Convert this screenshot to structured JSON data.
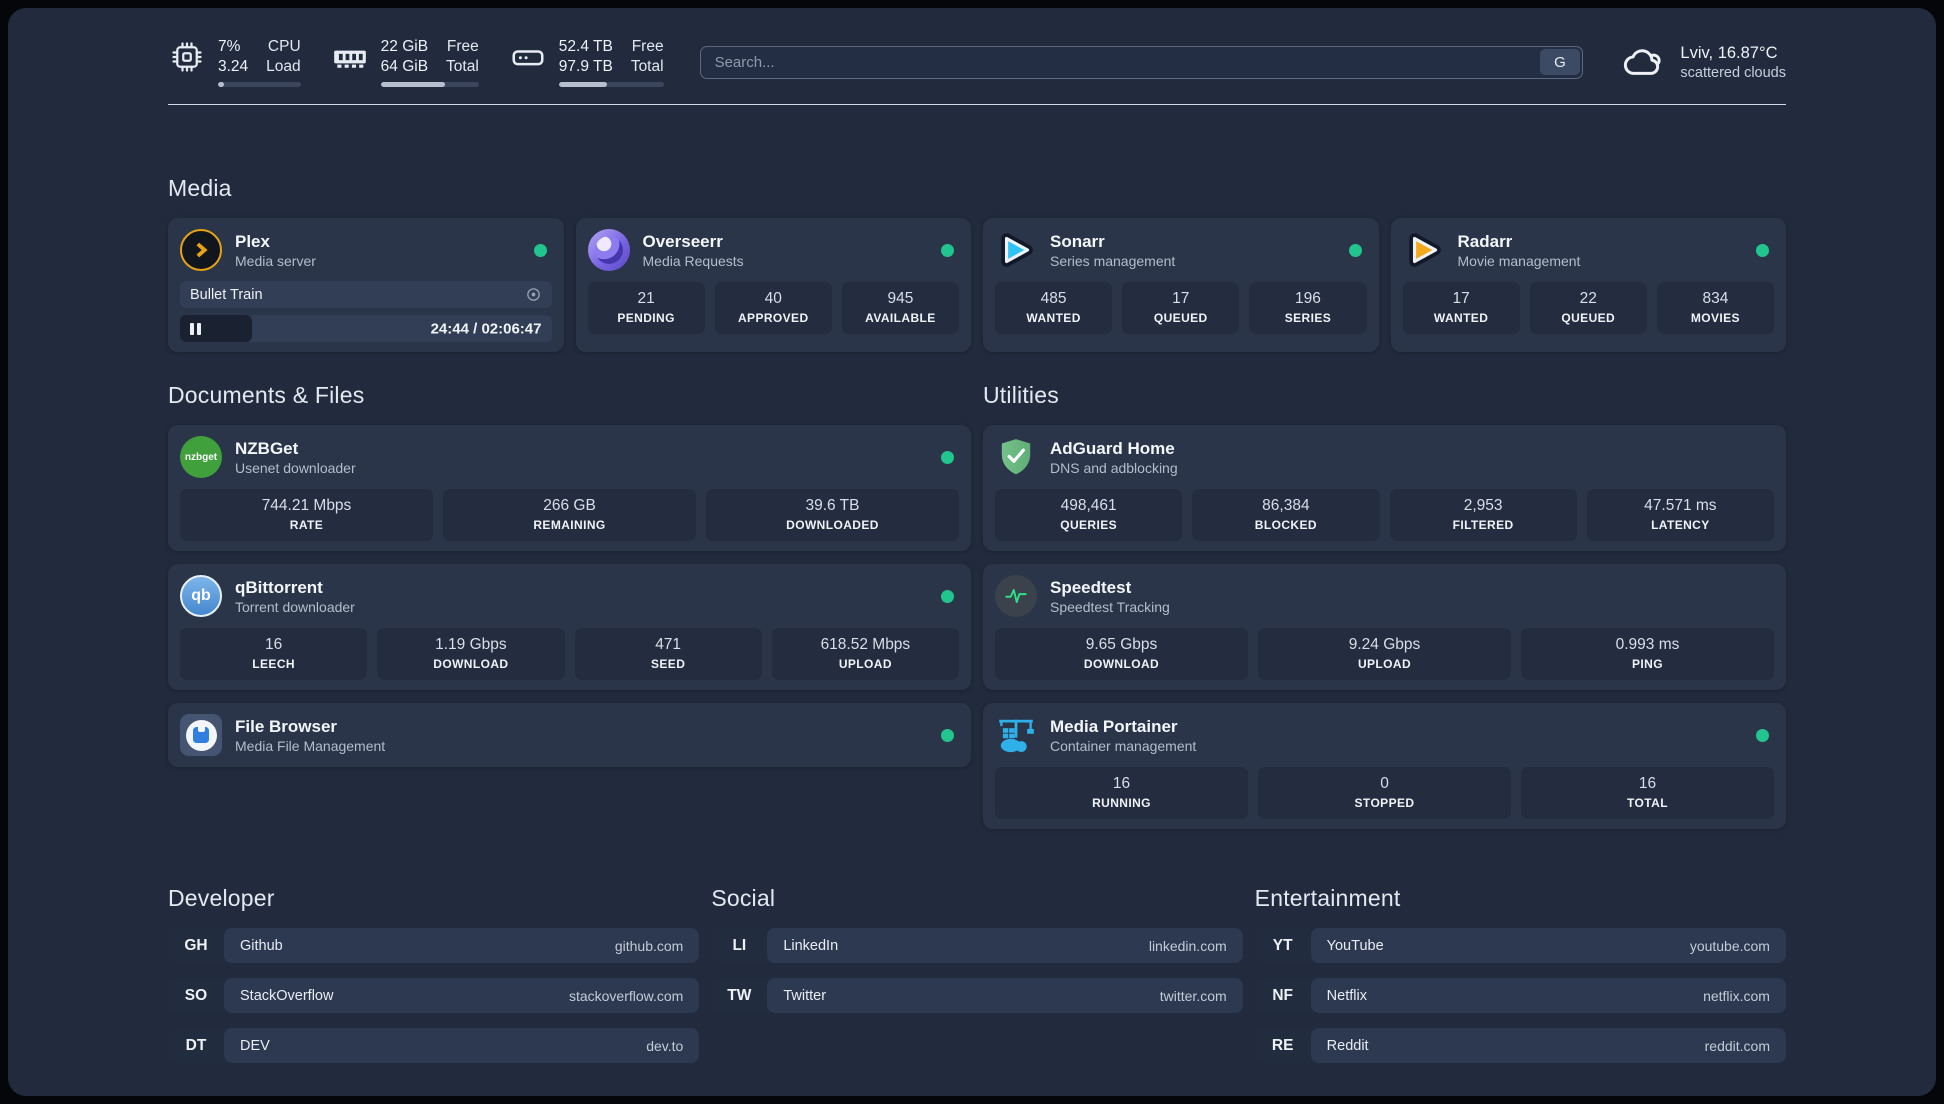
{
  "colors": {
    "status_online": "#22c58d"
  },
  "header": {
    "cpu": {
      "values": [
        "7%",
        "3.24"
      ],
      "labels": [
        "CPU",
        "Load"
      ],
      "progress": 7
    },
    "ram": {
      "values": [
        "22 GiB",
        "64 GiB"
      ],
      "labels": [
        "Free",
        "Total"
      ],
      "progress": 66
    },
    "disk": {
      "values": [
        "52.4 TB",
        "97.9 TB"
      ],
      "labels": [
        "Free",
        "Total"
      ],
      "progress": 46
    },
    "search": {
      "placeholder": "Search...",
      "engine_label": "G"
    },
    "weather": {
      "summary": "Lviv, 16.87°C",
      "condition": "scattered clouds"
    }
  },
  "media": {
    "title": "Media",
    "cards": [
      {
        "name": "Plex",
        "desc": "Media server",
        "player": {
          "title": "Bullet Train",
          "time": "24:44 / 02:06:47",
          "progress": 19.5
        }
      },
      {
        "name": "Overseerr",
        "desc": "Media Requests",
        "stats": [
          {
            "v": "21",
            "l": "PENDING"
          },
          {
            "v": "40",
            "l": "APPROVED"
          },
          {
            "v": "945",
            "l": "AVAILABLE"
          }
        ]
      },
      {
        "name": "Sonarr",
        "desc": "Series management",
        "stats": [
          {
            "v": "485",
            "l": "WANTED"
          },
          {
            "v": "17",
            "l": "QUEUED"
          },
          {
            "v": "196",
            "l": "SERIES"
          }
        ]
      },
      {
        "name": "Radarr",
        "desc": "Movie management",
        "stats": [
          {
            "v": "17",
            "l": "WANTED"
          },
          {
            "v": "22",
            "l": "QUEUED"
          },
          {
            "v": "834",
            "l": "MOVIES"
          }
        ]
      }
    ]
  },
  "documents": {
    "title": "Documents & Files",
    "cards": [
      {
        "name": "NZBGet",
        "desc": "Usenet downloader",
        "icon_text": "nzbget",
        "stats": [
          {
            "v": "744.21 Mbps",
            "l": "RATE"
          },
          {
            "v": "266 GB",
            "l": "REMAINING"
          },
          {
            "v": "39.6 TB",
            "l": "DOWNLOADED"
          }
        ]
      },
      {
        "name": "qBittorrent",
        "desc": "Torrent downloader",
        "icon_text": "qb",
        "stats": [
          {
            "v": "16",
            "l": "LEECH"
          },
          {
            "v": "1.19 Gbps",
            "l": "DOWNLOAD"
          },
          {
            "v": "471",
            "l": "SEED"
          },
          {
            "v": "618.52 Mbps",
            "l": "UPLOAD"
          }
        ]
      },
      {
        "name": "File Browser",
        "desc": "Media File Management"
      }
    ]
  },
  "utilities": {
    "title": "Utilities",
    "cards": [
      {
        "name": "AdGuard Home",
        "desc": "DNS and adblocking",
        "stats": [
          {
            "v": "498,461",
            "l": "QUERIES"
          },
          {
            "v": "86,384",
            "l": "BLOCKED"
          },
          {
            "v": "2,953",
            "l": "FILTERED"
          },
          {
            "v": "47.571 ms",
            "l": "LATENCY"
          }
        ]
      },
      {
        "name": "Speedtest",
        "desc": "Speedtest Tracking",
        "stats": [
          {
            "v": "9.65 Gbps",
            "l": "DOWNLOAD"
          },
          {
            "v": "9.24 Gbps",
            "l": "UPLOAD"
          },
          {
            "v": "0.993 ms",
            "l": "PING"
          }
        ]
      },
      {
        "name": "Media Portainer",
        "desc": "Container management",
        "stats": [
          {
            "v": "16",
            "l": "RUNNING"
          },
          {
            "v": "0",
            "l": "STOPPED"
          },
          {
            "v": "16",
            "l": "TOTAL"
          }
        ]
      }
    ]
  },
  "bookmarks": {
    "groups": [
      {
        "title": "Developer",
        "items": [
          {
            "abbr": "GH",
            "name": "Github",
            "url": "github.com"
          },
          {
            "abbr": "SO",
            "name": "StackOverflow",
            "url": "stackoverflow.com"
          },
          {
            "abbr": "DT",
            "name": "DEV",
            "url": "dev.to"
          }
        ]
      },
      {
        "title": "Social",
        "items": [
          {
            "abbr": "LI",
            "name": "LinkedIn",
            "url": "linkedin.com"
          },
          {
            "abbr": "TW",
            "name": "Twitter",
            "url": "twitter.com"
          }
        ]
      },
      {
        "title": "Entertainment",
        "items": [
          {
            "abbr": "YT",
            "name": "YouTube",
            "url": "youtube.com"
          },
          {
            "abbr": "NF",
            "name": "Netflix",
            "url": "netflix.com"
          },
          {
            "abbr": "RE",
            "name": "Reddit",
            "url": "reddit.com"
          }
        ]
      }
    ]
  }
}
